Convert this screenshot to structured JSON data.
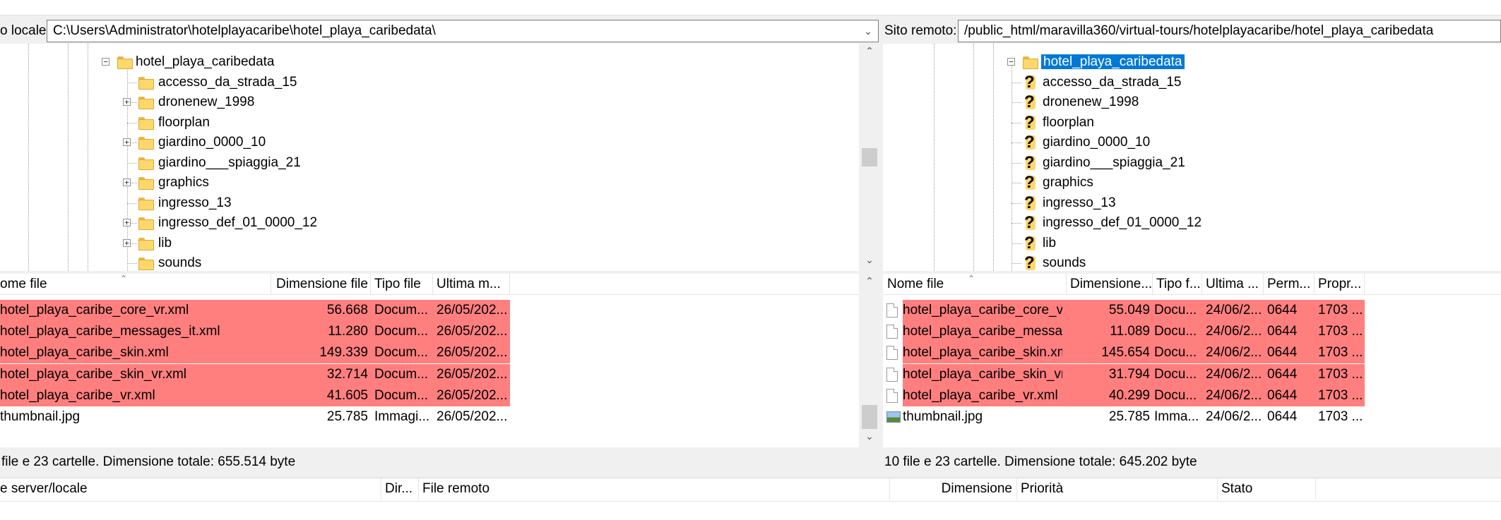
{
  "local": {
    "path_label": "o locale:",
    "path_value": "C:\\Users\\Administrator\\hotelplayacaribe\\hotel_playa_caribedata\\",
    "tree": {
      "root_label": "hotel_playa_caribedata",
      "items": [
        {
          "label": "accesso_da_strada_15",
          "expandable": false
        },
        {
          "label": "dronenew_1998",
          "expandable": true
        },
        {
          "label": "floorplan",
          "expandable": false
        },
        {
          "label": "giardino_0000_10",
          "expandable": true
        },
        {
          "label": "giardino___spiaggia_21",
          "expandable": false
        },
        {
          "label": "graphics",
          "expandable": true
        },
        {
          "label": "ingresso_13",
          "expandable": false
        },
        {
          "label": "ingresso_def_01_0000_12",
          "expandable": true
        },
        {
          "label": "lib",
          "expandable": true
        },
        {
          "label": "sounds",
          "expandable": false
        }
      ]
    },
    "columns": [
      "ome file",
      "Dimensione file",
      "Tipo file",
      "Ultima m..."
    ],
    "files": [
      {
        "name": "hotel_playa_caribe_core_vr.xml",
        "size": "56.668",
        "type": "Docum...",
        "modified": "26/05/202...",
        "highlight": true
      },
      {
        "name": "hotel_playa_caribe_messages_it.xml",
        "size": "11.280",
        "type": "Docum...",
        "modified": "26/05/202...",
        "highlight": true
      },
      {
        "name": "hotel_playa_caribe_skin.xml",
        "size": "149.339",
        "type": "Docum...",
        "modified": "26/05/202...",
        "highlight": true
      },
      {
        "name": "hotel_playa_caribe_skin_vr.xml",
        "size": "32.714",
        "type": "Docum...",
        "modified": "26/05/202...",
        "highlight": true
      },
      {
        "name": "hotel_playa_caribe_vr.xml",
        "size": "41.605",
        "type": "Docum...",
        "modified": "26/05/202...",
        "highlight": true
      },
      {
        "name": "thumbnail.jpg",
        "size": "25.785",
        "type": "Immagi...",
        "modified": "26/05/202...",
        "highlight": false
      }
    ],
    "status": "file e 23 cartelle. Dimensione totale: 655.514 byte"
  },
  "remote": {
    "path_label": "Sito remoto:",
    "path_value": "/public_html/maravilla360/virtual-tours/hotelplayacaribe/hotel_playa_caribedata",
    "tree": {
      "root_label": "hotel_playa_caribedata",
      "items": [
        {
          "label": "accesso_da_strada_15"
        },
        {
          "label": "dronenew_1998"
        },
        {
          "label": "floorplan"
        },
        {
          "label": "giardino_0000_10"
        },
        {
          "label": "giardino___spiaggia_21"
        },
        {
          "label": "graphics"
        },
        {
          "label": "ingresso_13"
        },
        {
          "label": "ingresso_def_01_0000_12"
        },
        {
          "label": "lib"
        },
        {
          "label": "sounds"
        }
      ]
    },
    "columns": [
      "Nome file",
      "Dimensione...",
      "Tipo f...",
      "Ultima ...",
      "Perm...",
      "Propr..."
    ],
    "files": [
      {
        "name": "hotel_playa_caribe_core_v...",
        "size": "55.049",
        "type": "Docu...",
        "modified": "24/06/2...",
        "perm": "0644",
        "owner": "1703 ...",
        "highlight": true
      },
      {
        "name": "hotel_playa_caribe_messa...",
        "size": "11.089",
        "type": "Docu...",
        "modified": "24/06/2...",
        "perm": "0644",
        "owner": "1703 ...",
        "highlight": true
      },
      {
        "name": "hotel_playa_caribe_skin.xml",
        "size": "145.654",
        "type": "Docu...",
        "modified": "24/06/2...",
        "perm": "0644",
        "owner": "1703 ...",
        "highlight": true
      },
      {
        "name": "hotel_playa_caribe_skin_vr...",
        "size": "31.794",
        "type": "Docu...",
        "modified": "24/06/2...",
        "perm": "0644",
        "owner": "1703 ...",
        "highlight": true
      },
      {
        "name": "hotel_playa_caribe_vr.xml",
        "size": "40.299",
        "type": "Docu...",
        "modified": "24/06/2...",
        "perm": "0644",
        "owner": "1703 ...",
        "highlight": true
      },
      {
        "name": "thumbnail.jpg",
        "size": "25.785",
        "type": "Imma...",
        "modified": "24/06/2...",
        "perm": "0644",
        "owner": "1703 ...",
        "highlight": false
      }
    ],
    "status": "10 file e 23 cartelle. Dimensione totale: 645.202 byte"
  },
  "queue": {
    "columns": [
      "e server/locale",
      "Dir...",
      "File remoto",
      "Dimensione",
      "Priorità",
      "Stato"
    ]
  },
  "colors": {
    "highlight_red": "#ff7f7f",
    "selection_blue": "#0078d7"
  }
}
